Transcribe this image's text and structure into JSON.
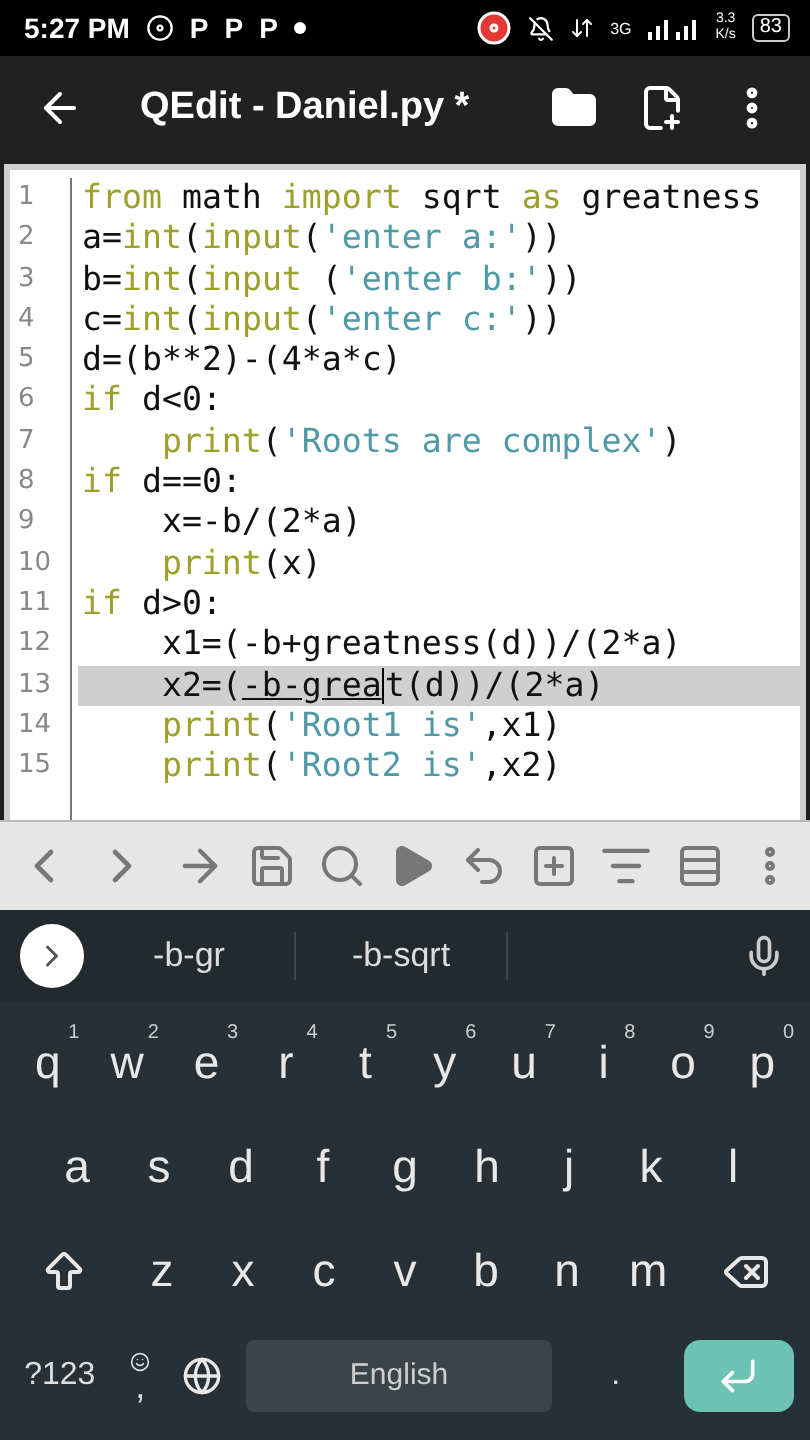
{
  "status_bar": {
    "time": "5:27 PM",
    "notifications": [
      "P",
      "P",
      "P"
    ],
    "network": "3G",
    "speed_value": "3.3",
    "speed_unit": "K/s",
    "battery": "83"
  },
  "app_bar": {
    "title": "QEdit - Daniel.py *"
  },
  "editor": {
    "lines": [
      {
        "number": "1",
        "highlighted": false,
        "tokens": [
          {
            "kind": "keyword",
            "text": "from"
          },
          {
            "kind": "plain",
            "text": " math "
          },
          {
            "kind": "keyword",
            "text": "import"
          },
          {
            "kind": "plain",
            "text": " sqrt "
          },
          {
            "kind": "keyword",
            "text": "as"
          },
          {
            "kind": "plain",
            "text": " greatness"
          }
        ]
      },
      {
        "number": "2",
        "highlighted": false,
        "tokens": [
          {
            "kind": "plain",
            "text": "a="
          },
          {
            "kind": "keyword",
            "text": "int"
          },
          {
            "kind": "plain",
            "text": "("
          },
          {
            "kind": "keyword",
            "text": "input"
          },
          {
            "kind": "plain",
            "text": "("
          },
          {
            "kind": "string",
            "text": "'enter a:'"
          },
          {
            "kind": "plain",
            "text": "))"
          }
        ]
      },
      {
        "number": "3",
        "highlighted": false,
        "tokens": [
          {
            "kind": "plain",
            "text": "b="
          },
          {
            "kind": "keyword",
            "text": "int"
          },
          {
            "kind": "plain",
            "text": "("
          },
          {
            "kind": "keyword",
            "text": "input"
          },
          {
            "kind": "plain",
            "text": " ("
          },
          {
            "kind": "string",
            "text": "'enter b:'"
          },
          {
            "kind": "plain",
            "text": "))"
          }
        ]
      },
      {
        "number": "4",
        "highlighted": false,
        "tokens": [
          {
            "kind": "plain",
            "text": "c="
          },
          {
            "kind": "keyword",
            "text": "int"
          },
          {
            "kind": "plain",
            "text": "("
          },
          {
            "kind": "keyword",
            "text": "input"
          },
          {
            "kind": "plain",
            "text": "("
          },
          {
            "kind": "string",
            "text": "'enter c:'"
          },
          {
            "kind": "plain",
            "text": "))"
          }
        ]
      },
      {
        "number": "5",
        "highlighted": false,
        "tokens": [
          {
            "kind": "plain",
            "text": "d=(b**2)-(4*a*c)"
          }
        ]
      },
      {
        "number": "6",
        "highlighted": false,
        "tokens": [
          {
            "kind": "keyword",
            "text": "if"
          },
          {
            "kind": "plain",
            "text": " d<0:"
          }
        ]
      },
      {
        "number": "7",
        "highlighted": false,
        "indented": true,
        "tokens": [
          {
            "kind": "keyword",
            "text": "print"
          },
          {
            "kind": "plain",
            "text": "("
          },
          {
            "kind": "string",
            "text": "'Roots are complex'"
          },
          {
            "kind": "plain",
            "text": ")"
          }
        ]
      },
      {
        "number": "8",
        "highlighted": false,
        "tokens": [
          {
            "kind": "keyword",
            "text": "if"
          },
          {
            "kind": "plain",
            "text": " d==0:"
          }
        ]
      },
      {
        "number": "9",
        "highlighted": false,
        "indented": true,
        "tokens": [
          {
            "kind": "plain",
            "text": "x=-b/(2*a)"
          }
        ]
      },
      {
        "number": "10",
        "highlighted": false,
        "indented": true,
        "tokens": [
          {
            "kind": "keyword",
            "text": "print"
          },
          {
            "kind": "plain",
            "text": "(x)"
          }
        ]
      },
      {
        "number": "11",
        "highlighted": false,
        "tokens": [
          {
            "kind": "keyword",
            "text": "if"
          },
          {
            "kind": "plain",
            "text": " d>0:"
          }
        ]
      },
      {
        "number": "12",
        "highlighted": false,
        "indented": true,
        "tokens": [
          {
            "kind": "plain",
            "text": "x1=(-b+greatness(d))/(2*a)"
          }
        ]
      },
      {
        "number": "13",
        "highlighted": true,
        "indented": true,
        "tokens": [
          {
            "kind": "plain",
            "text": "x2=("
          },
          {
            "kind": "composing",
            "text": "-b-grea"
          },
          {
            "kind": "cursor"
          },
          {
            "kind": "plain",
            "text": "t(d))/(2*a)"
          }
        ]
      },
      {
        "number": "14",
        "highlighted": false,
        "indented": true,
        "tokens": [
          {
            "kind": "keyword",
            "text": "print"
          },
          {
            "kind": "plain",
            "text": "("
          },
          {
            "kind": "string",
            "text": "'Root1 is'"
          },
          {
            "kind": "plain",
            "text": ",x1)"
          }
        ]
      },
      {
        "number": "15",
        "highlighted": false,
        "indented": true,
        "tokens": [
          {
            "kind": "keyword",
            "text": "print"
          },
          {
            "kind": "plain",
            "text": "("
          },
          {
            "kind": "string",
            "text": "'Root2 is'"
          },
          {
            "kind": "plain",
            "text": ",x2)"
          }
        ]
      }
    ]
  },
  "suggestions": [
    "-b-gr",
    "-b-sqrt"
  ],
  "keyboard": {
    "rows": [
      {
        "keys": [
          {
            "kind": "letter",
            "label": "q",
            "hint": "1"
          },
          {
            "kind": "letter",
            "label": "w",
            "hint": "2"
          },
          {
            "kind": "letter",
            "label": "e",
            "hint": "3"
          },
          {
            "kind": "letter",
            "label": "r",
            "hint": "4"
          },
          {
            "kind": "letter",
            "label": "t",
            "hint": "5"
          },
          {
            "kind": "letter",
            "label": "y",
            "hint": "6"
          },
          {
            "kind": "letter",
            "label": "u",
            "hint": "7"
          },
          {
            "kind": "letter",
            "label": "i",
            "hint": "8"
          },
          {
            "kind": "letter",
            "label": "o",
            "hint": "9"
          },
          {
            "kind": "letter",
            "label": "p",
            "hint": "0"
          }
        ]
      },
      {
        "keys": [
          {
            "kind": "letter",
            "label": "a"
          },
          {
            "kind": "letter",
            "label": "s"
          },
          {
            "kind": "letter",
            "label": "d"
          },
          {
            "kind": "letter",
            "label": "f"
          },
          {
            "kind": "letter",
            "label": "g"
          },
          {
            "kind": "letter",
            "label": "h"
          },
          {
            "kind": "letter",
            "label": "j"
          },
          {
            "kind": "letter",
            "label": "k"
          },
          {
            "kind": "letter",
            "label": "l"
          }
        ]
      },
      {
        "keys": [
          {
            "kind": "shift"
          },
          {
            "kind": "letter",
            "label": "z"
          },
          {
            "kind": "letter",
            "label": "x"
          },
          {
            "kind": "letter",
            "label": "c"
          },
          {
            "kind": "letter",
            "label": "v"
          },
          {
            "kind": "letter",
            "label": "b"
          },
          {
            "kind": "letter",
            "label": "n"
          },
          {
            "kind": "letter",
            "label": "m"
          },
          {
            "kind": "backspace"
          }
        ]
      },
      {
        "keys": [
          {
            "kind": "symbols",
            "label": "?123"
          },
          {
            "kind": "comma",
            "label": ","
          },
          {
            "kind": "globe"
          },
          {
            "kind": "space",
            "label": "English"
          },
          {
            "kind": "period",
            "label": "."
          },
          {
            "kind": "enter"
          }
        ]
      }
    ]
  }
}
